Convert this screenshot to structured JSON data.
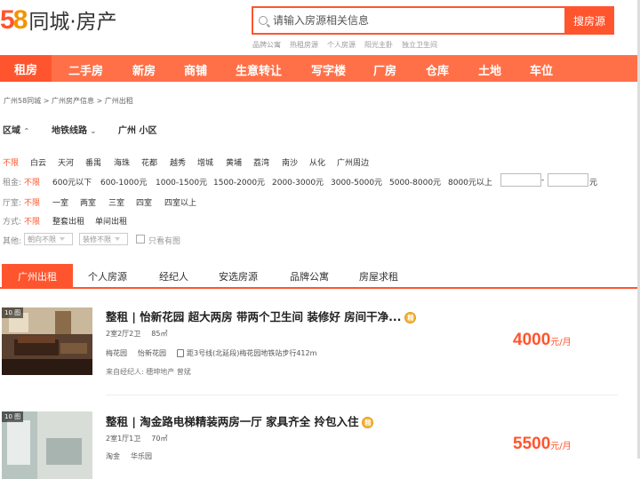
{
  "header": {
    "logo_5": "5",
    "logo_8": "8",
    "logo_text": "同城·房产",
    "search_placeholder": "请输入房源相关信息",
    "search_button": "搜房源",
    "hot_links": [
      "品牌公寓",
      "热租房源",
      "个人房源",
      "阳光主卧",
      "独立卫生间"
    ]
  },
  "nav": {
    "items": [
      "租房",
      "二手房",
      "新房",
      "商铺",
      "生意转让",
      "写字楼",
      "厂房",
      "仓库",
      "土地",
      "车位"
    ],
    "active": "租房"
  },
  "breadcrumb": [
    "广州58同城",
    "广州房产信息",
    "广州出租"
  ],
  "breadcrumb_sep": ">",
  "filter_tabs": [
    "区域",
    "地铁线路",
    "广州 小区"
  ],
  "district": {
    "selected": "不限",
    "items": [
      "白云",
      "天河",
      "番禺",
      "海珠",
      "花都",
      "越秀",
      "增城",
      "黄埔",
      "荔湾",
      "南沙",
      "从化",
      "广州周边"
    ]
  },
  "rent": {
    "label": "租金:",
    "selected": "不限",
    "items": [
      "600元以下",
      "600-1000元",
      "1000-1500元",
      "1500-2000元",
      "2000-3000元",
      "3000-5000元",
      "5000-8000元",
      "8000元以上"
    ],
    "dash": "-",
    "unit": "元"
  },
  "rooms": {
    "label": "厅室:",
    "selected": "不限",
    "items": [
      "一室",
      "两室",
      "三室",
      "四室",
      "四室以上"
    ]
  },
  "method": {
    "label": "方式:",
    "selected": "不限",
    "items": [
      "整套出租",
      "单间出租"
    ]
  },
  "other": {
    "label": "其他:",
    "orientation": "朝向不限",
    "decoration": "装修不限",
    "image_only": "只看有图"
  },
  "tabs": {
    "items": [
      "广州出租",
      "个人房源",
      "经纪人",
      "安选房源",
      "品牌公寓",
      "房屋求租"
    ],
    "active": "广州出租"
  },
  "listings": [
    {
      "count": "10 图",
      "title": "整租 | 怡新花园 超大两房 带两个卫生间 装修好 房间干净...",
      "badge": "精",
      "layout": "2室2厅2卫",
      "area": "85㎡",
      "estate": "梅花园",
      "community": "怡新花园",
      "distance": "距3号线(北延段)梅花园地铁站步行412m",
      "source": "来自经纪人: 穗坤地产 曾斌",
      "price": "4000",
      "unit": "元/月"
    },
    {
      "count": "10 图",
      "title": "整租 | 淘金路电梯精装两房一厅 家具齐全 拎包入住",
      "badge": "精",
      "layout": "2室1厅1卫",
      "area": "70㎡",
      "estate": "淘金",
      "community": "华乐园",
      "price": "5500",
      "unit": "元/月"
    }
  ],
  "colors": {
    "brand": "#ff552e",
    "nav": "#ff7048",
    "badge": "#f6b33a"
  }
}
